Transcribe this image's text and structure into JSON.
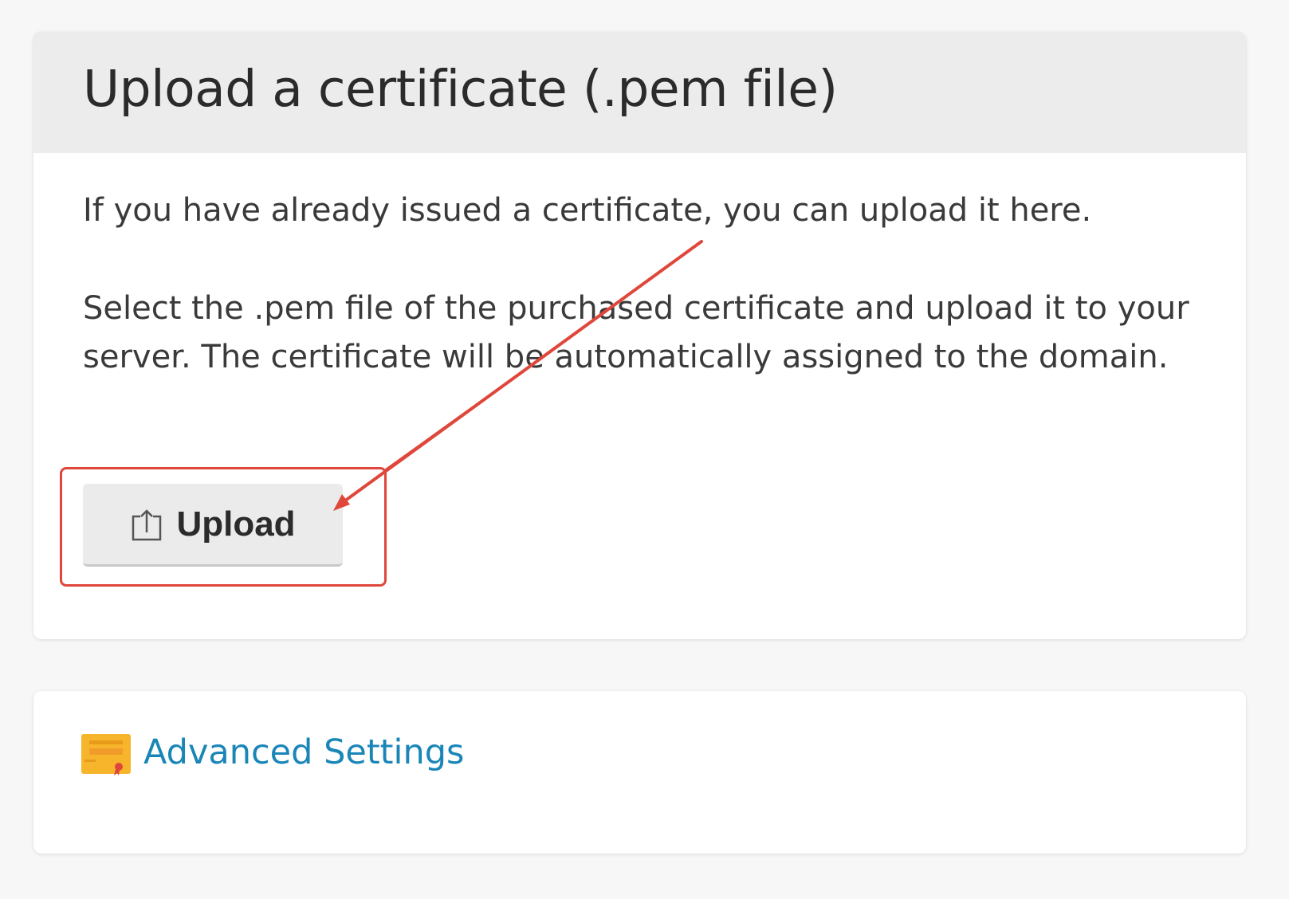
{
  "upload_panel": {
    "title": "Upload a certificate (.pem file)",
    "intro_text": "If you have already issued a certificate, you can upload it here.",
    "instruction_text": "Select the .pem file of the purchased certificate and upload it to your server. The certificate will be automatically assigned to the domain.",
    "upload_button": {
      "label": "Upload",
      "icon": "upload-icon"
    }
  },
  "advanced_panel": {
    "link_label": "Advanced Settings",
    "icon": "certificate-icon"
  },
  "colors": {
    "annotation": "#e0473b",
    "link": "#1a86b8",
    "header_bg": "#ececec",
    "certificate_icon": "#f7b52c"
  }
}
